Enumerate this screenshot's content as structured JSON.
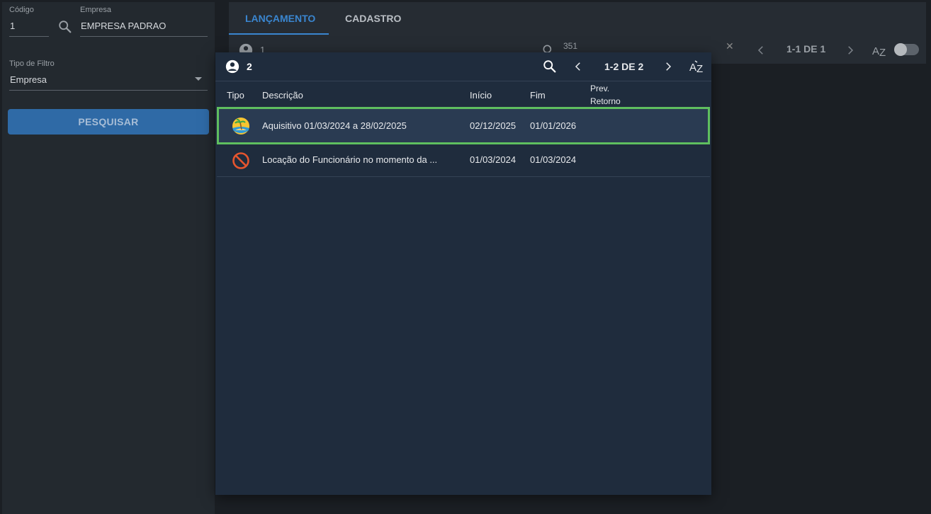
{
  "filter": {
    "codigo_label": "Código",
    "codigo_value": "1",
    "empresa_label": "Empresa",
    "empresa_value": "EMPRESA PADRAO",
    "tipo_filtro_label": "Tipo de Filtro",
    "tipo_filtro_value": "Empresa",
    "search_button": "PESQUISAR"
  },
  "tabs": [
    {
      "label": "LANÇAMENTO",
      "active": true
    },
    {
      "label": "CADASTRO",
      "active": false
    }
  ],
  "background_toolbar": {
    "count": "1",
    "search_value": "351",
    "pagination": "1-1 DE 1"
  },
  "modal": {
    "count": "2",
    "pagination": "1-2 DE 2",
    "columns": {
      "tipo": "Tipo",
      "descricao": "Descrição",
      "inicio": "Início",
      "fim": "Fim",
      "prev_retorno_1": "Prev.",
      "prev_retorno_2": "Retorno"
    },
    "rows": [
      {
        "icon": "vacation-beach-icon",
        "descricao": "Aquisitivo 01/03/2024 a 28/02/2025",
        "inicio": "02/12/2025",
        "fim": "01/01/2026",
        "prev_retorno": ""
      },
      {
        "icon": "prohibited-icon",
        "descricao": "Locação do Funcionário no momento da ...",
        "inicio": "01/03/2024",
        "fim": "01/03/2024",
        "prev_retorno": ""
      }
    ]
  },
  "colors": {
    "accent": "#3a86d0",
    "selected_border": "#5fbf5f",
    "prohibited": "#e6552e"
  }
}
